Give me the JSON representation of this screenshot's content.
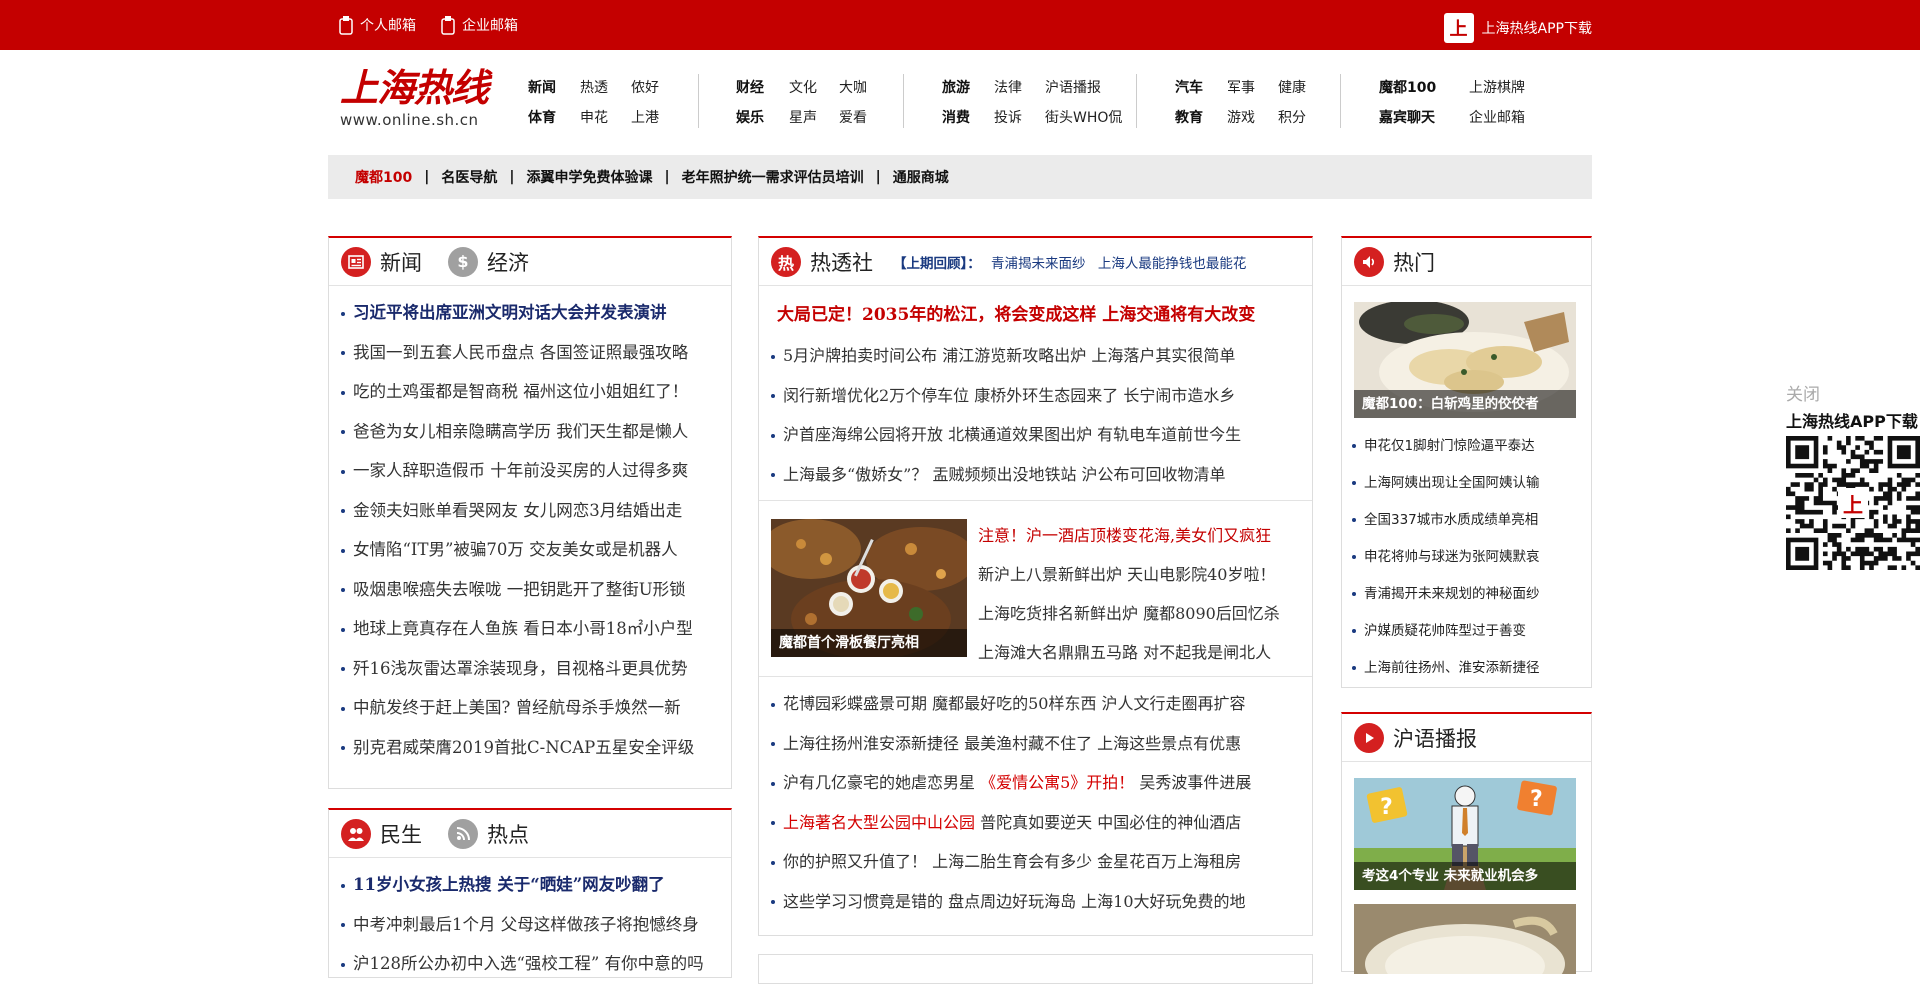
{
  "topbar": {
    "personal_mail": "个人邮箱",
    "enterprise_mail": "企业邮箱",
    "app_download": "上海热线APP下载",
    "app_logo_char": "上"
  },
  "logo": {
    "cn": "上海热线",
    "url": "www.online.sh.cn"
  },
  "nav": [
    {
      "row1": [
        "新闻",
        "热透",
        "侬好"
      ],
      "row2": [
        "体育",
        "申花",
        "上港"
      ]
    },
    {
      "row1": [
        "财经",
        "文化",
        "大咖"
      ],
      "row2": [
        "娱乐",
        "星声",
        "爱看"
      ]
    },
    {
      "row1": [
        "旅游",
        "法律",
        "沪语播报"
      ],
      "row2": [
        "消费",
        "投诉",
        "街头WHO侃"
      ]
    },
    {
      "row1": [
        "汽车",
        "军事",
        "健康"
      ],
      "row2": [
        "教育",
        "游戏",
        "积分"
      ]
    },
    {
      "row1": [
        "魔都100",
        "上游棋牌"
      ],
      "row2": [
        "嘉宾聊天",
        "企业邮箱"
      ]
    }
  ],
  "strip": [
    "魔都100",
    "名医导航",
    "添翼申学免费体验课",
    "老年照护统一需求评估员培训",
    "通服商城"
  ],
  "news_panel": {
    "tab1": "新闻",
    "tab2": "经济",
    "items": [
      "习近平将出席亚洲文明对话大会并发表演讲",
      "我国一到五套人民币盘点  各国签证照最强攻略",
      "吃的土鸡蛋都是智商税  福州这位小姐姐红了！",
      "爸爸为女儿相亲隐瞒高学历  我们天生都是懒人",
      "一家人辞职造假币  十年前没买房的人过得多爽",
      "金领夫妇账单看哭网友  女儿网恋3月结婚出走",
      "女情陷“IT男”被骗70万  交友美女或是机器人",
      "吸烟患喉癌失去喉咙  一把钥匙开了整街U形锁",
      "地球上竟真存在人鱼族  看日本小哥18㎡小户型",
      "歼16浅灰雷达罩涂装现身，目视格斗更具优势",
      "中航发终于赶上美国? 曾经航母杀手焕然一新",
      "别克君威荣膺2019首批C-NCAP五星安全评级"
    ]
  },
  "min_panel": {
    "tab1": "民生",
    "tab2": "热点",
    "items": [
      "11岁小女孩上热搜 关于“晒娃”网友吵翻了",
      "中考冲刺最后1个月  父母这样做孩子将抱憾终身",
      "沪128所公办初中入选“强校工程” 有你中意的吗"
    ]
  },
  "hot_panel": {
    "title": "热透社",
    "ticker_label": "【上期回顾】：",
    "ticker_items": [
      "青浦揭未来面纱",
      "上海人最能挣钱也最能花"
    ],
    "headline": "大局已定！2035年的松江，将会变成这样  上海交通将有大改变",
    "group1": [
      "5月沪牌拍卖时间公布  浦江游览新攻略出炉  上海落户其实很简单",
      "闵行新增优化2万个停车位  康桥外环生态园来了  长宁闹市造水乡",
      "沪首座海绵公园将开放  北横通道效果图出炉  有轨电车道前世今生",
      "上海最多“傲娇女”？  盂贼频频出没地铁站  沪公布可回收物清单"
    ],
    "image_caption": "魔都首个滑板餐厅亮相",
    "group2_red": "注意！沪一酒店顶楼变花海,美女们又疯狂",
    "group2": [
      "新沪上八景新鲜出炉  天山电影院40岁啦！",
      "上海吃货排名新鲜出炉  魔都8090后回忆杀",
      "上海滩大名鼎鼎五马路  对不起我是闸北人"
    ],
    "group3": [
      [
        "花博园彩蝶盛景可期  魔都最好吃的50样东西  沪人文行走圈再扩容",
        ""
      ],
      [
        "上海往扬州淮安添新捷径  最美渔村藏不住了  上海这些景点有优惠",
        ""
      ],
      [
        "沪有几亿豪宅的她虐恋男星  ",
        "《爱情公寓5》开拍！",
        "  吴秀波事件进展"
      ],
      [
        "",
        "上海著名大型公园中山公园",
        "  普陀真如要逆天  中国必住的神仙酒店"
      ],
      [
        "你的护照又升值了！  上海二胎生育会有多少  金星花百万上海租房",
        ""
      ],
      [
        "这些学习习惯竟是错的  盘点周边好玩海岛  上海10大好玩免费的地",
        ""
      ]
    ]
  },
  "hot_side": {
    "title": "热门",
    "image_caption": "魔都100：白斩鸡里的佼佼者",
    "items": [
      "申花仅1脚射门惊险逼平泰达",
      "上海阿姨出现让全国阿姨认输",
      "全国337城市水质成绩单亮相",
      "申花将帅与球迷为张阿姨默哀",
      "青浦揭开未来规划的神秘面纱",
      "沪媒质疑花帅阵型过于善变",
      "上海前往扬州、淮安添新捷径"
    ]
  },
  "huyu": {
    "title": "沪语播报",
    "image_caption": "考这4个专业  未来就业机会多"
  },
  "float": {
    "close": "关闭",
    "title": "上海热线APP下载",
    "qr_char": "上"
  },
  "colors": {
    "brand_red": "#c40000",
    "link_blue": "#1a3a80"
  }
}
